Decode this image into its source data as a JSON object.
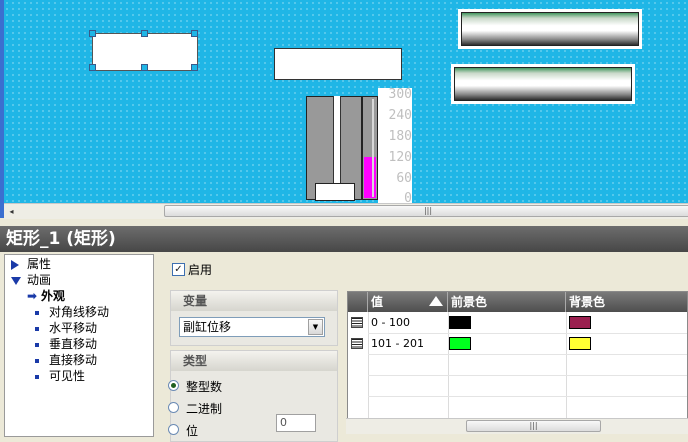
{
  "canvas": {
    "gauge_scale": [
      "300",
      "240",
      "180",
      "120",
      "60",
      "0"
    ],
    "gauge_level": 120,
    "gauge_max": 300
  },
  "scrollbar": {
    "left_arrow": "◂",
    "grip": "|||"
  },
  "inspector": {
    "title": "矩形_1 (矩形)",
    "nav": {
      "properties": "属性",
      "animation": "动画",
      "appearance": "外观",
      "items": [
        "对角线移动",
        "水平移动",
        "垂直移动",
        "直接移动",
        "可见性"
      ]
    },
    "enable": {
      "label": "启用",
      "checked": true
    },
    "variable": {
      "header": "变量",
      "value": "副缸位移"
    },
    "type": {
      "header": "类型",
      "options": [
        "整型数",
        "二进制",
        "位"
      ],
      "selected": 0,
      "bit_value": "0"
    },
    "table": {
      "columns": [
        "值",
        "前景色",
        "背景色"
      ],
      "rows": [
        {
          "value": "0 - 100",
          "fg": "#000000",
          "bg": "#9b1f4f"
        },
        {
          "value": "101 - 201",
          "fg": "#00ff1e",
          "bg": "#ffff33"
        }
      ]
    }
  }
}
